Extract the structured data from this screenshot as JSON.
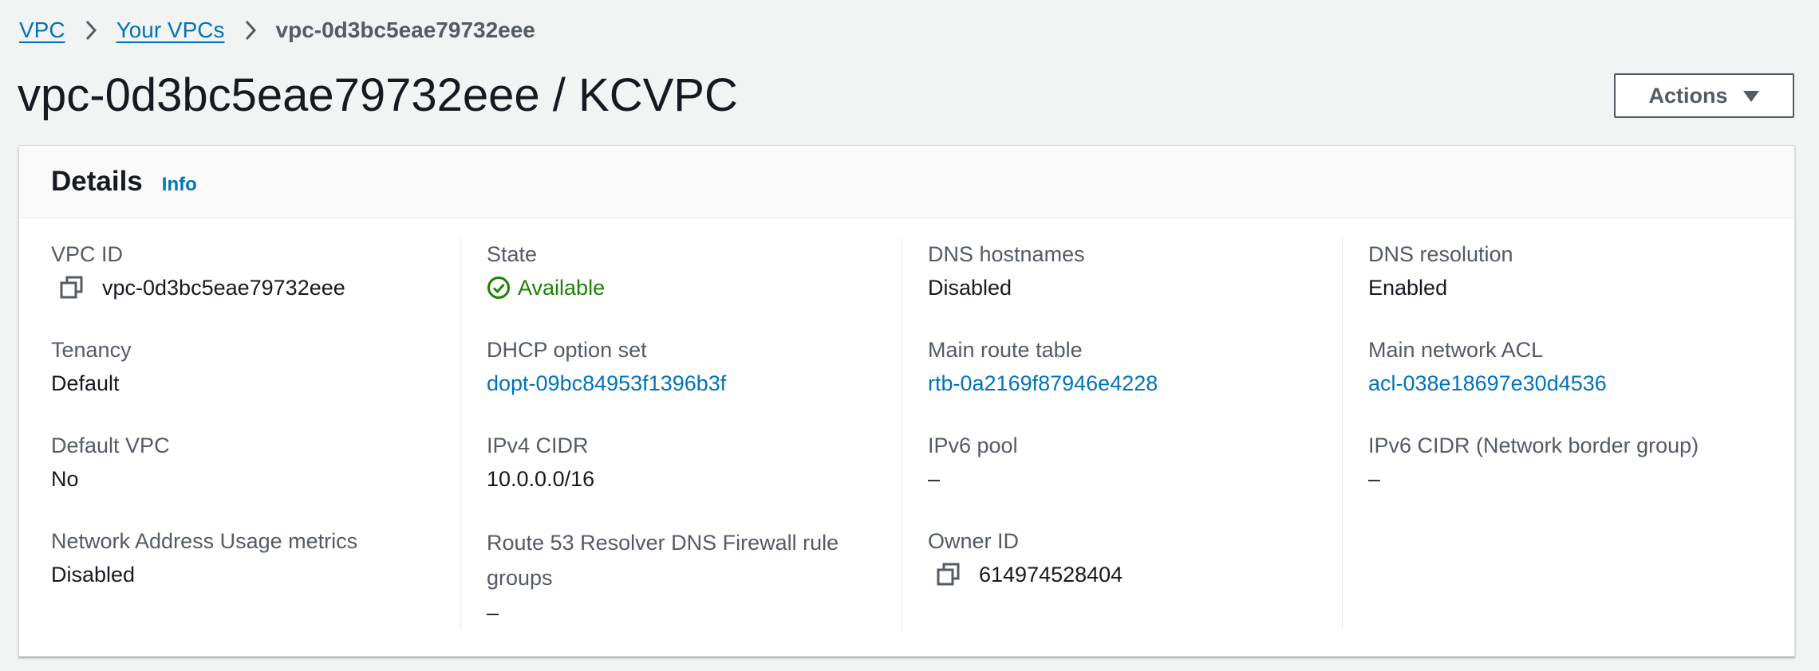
{
  "breadcrumb": {
    "items": [
      {
        "label": "VPC"
      },
      {
        "label": "Your VPCs"
      }
    ],
    "current": "vpc-0d3bc5eae79732eee"
  },
  "page": {
    "title": "vpc-0d3bc5eae79732eee / KCVPC",
    "actions_label": "Actions"
  },
  "details": {
    "title": "Details",
    "info_label": "Info",
    "vpc_id": {
      "label": "VPC ID",
      "value": "vpc-0d3bc5eae79732eee"
    },
    "tenancy": {
      "label": "Tenancy",
      "value": "Default"
    },
    "default_vpc": {
      "label": "Default VPC",
      "value": "No"
    },
    "nau_metrics": {
      "label": "Network Address Usage metrics",
      "value": "Disabled"
    },
    "state": {
      "label": "State",
      "value": "Available"
    },
    "dhcp": {
      "label": "DHCP option set",
      "value": "dopt-09bc84953f1396b3f"
    },
    "ipv4_cidr": {
      "label": "IPv4 CIDR",
      "value": "10.0.0.0/16"
    },
    "route53": {
      "label": "Route 53 Resolver DNS Firewall rule groups",
      "value": "–"
    },
    "dns_hostnames": {
      "label": "DNS hostnames",
      "value": "Disabled"
    },
    "main_route_table": {
      "label": "Main route table",
      "value": "rtb-0a2169f87946e4228"
    },
    "ipv6_pool": {
      "label": "IPv6 pool",
      "value": "–"
    },
    "owner_id": {
      "label": "Owner ID",
      "value": "614974528404"
    },
    "dns_resolution": {
      "label": "DNS resolution",
      "value": "Enabled"
    },
    "main_acl": {
      "label": "Main network ACL",
      "value": "acl-038e18697e30d4536"
    },
    "ipv6_cidr": {
      "label": "IPv6 CIDR (Network border group)",
      "value": "–"
    }
  },
  "colors": {
    "link": "#0073bb",
    "available": "#1d8102",
    "text": "#16191f",
    "label": "#545b64",
    "background": "#f2f3f3"
  }
}
